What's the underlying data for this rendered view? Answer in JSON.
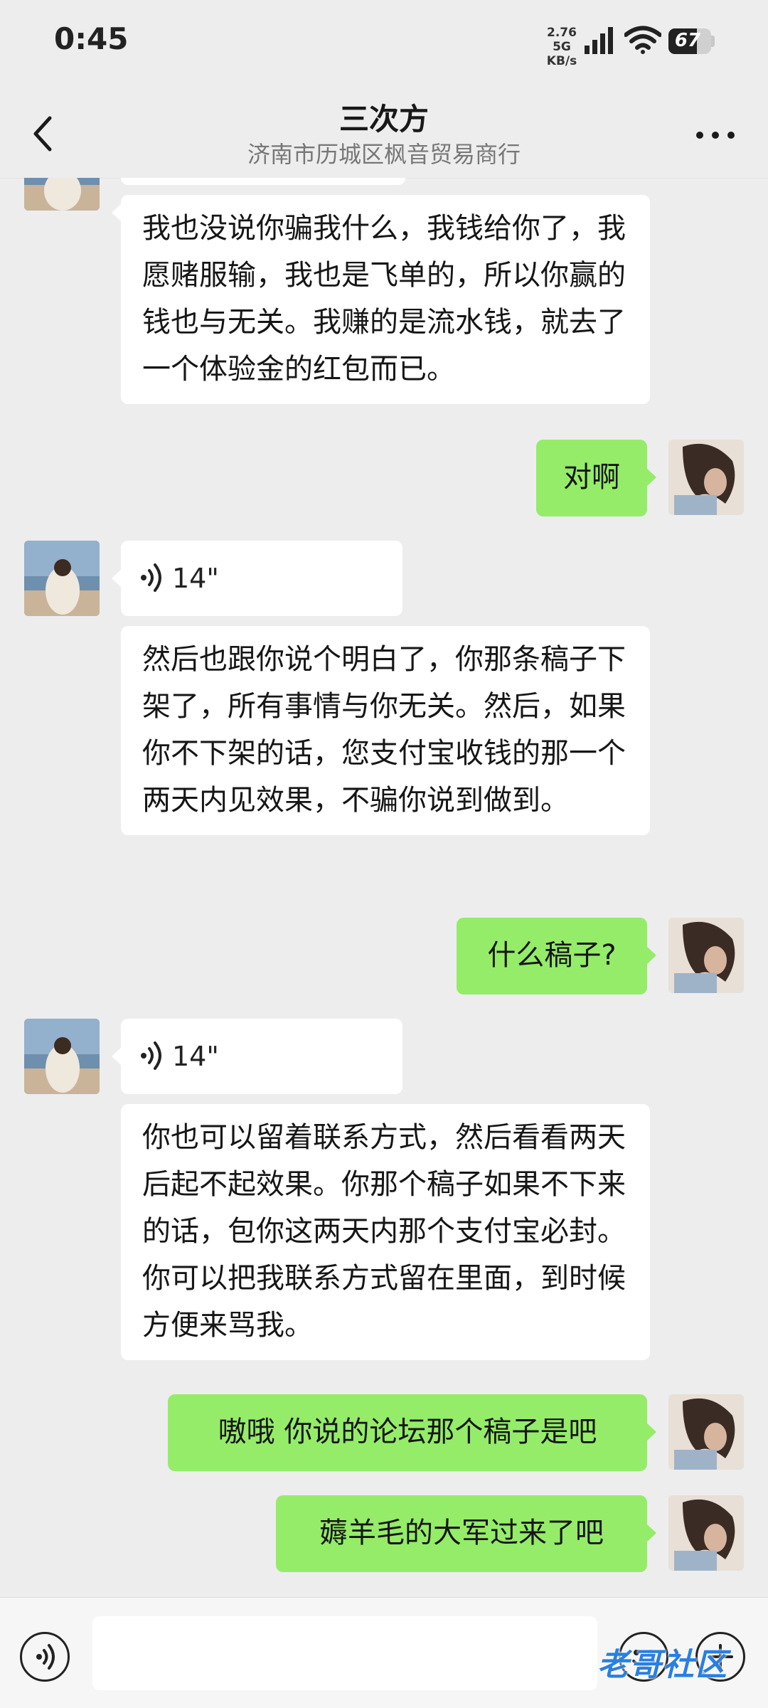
{
  "status_bar": {
    "time": "0:45",
    "net_speed_value": "2.76",
    "net_speed_unit": "KB/s",
    "network_type": "5G",
    "battery": "67",
    "battery_level": 0.67
  },
  "header": {
    "title": "三次方",
    "subtitle": "济南市历城区枫音贸易商行"
  },
  "messages": [
    {
      "side": "left",
      "type": "text",
      "text": "我也没说你骗我什么，我钱给你了，我愿赌服输，我也是飞单的，所以你赢的钱也与无关。我赚的是流水钱，就去了一个体验金的红包而已。"
    },
    {
      "side": "right",
      "type": "text",
      "text": "对啊"
    },
    {
      "side": "left",
      "type": "voice",
      "duration": "14\""
    },
    {
      "side": "left",
      "type": "text",
      "text": "然后也跟你说个明白了，你那条稿子下架了，所有事情与你无关。然后，如果你不下架的话，您支付宝收钱的那一个两天内见效果，不骗你说到做到。"
    },
    {
      "side": "right",
      "type": "text",
      "text": "什么稿子?"
    },
    {
      "side": "left",
      "type": "voice",
      "duration": "14\""
    },
    {
      "side": "left",
      "type": "text",
      "text": "你也可以留着联系方式，然后看看两天后起不起效果。你那个稿子如果不下来的话，包你这两天内那个支付宝必封。你可以把我联系方式留在里面，到时候方便来骂我。"
    },
    {
      "side": "right",
      "type": "text",
      "text": "嗷哦 你说的论坛那个稿子是吧"
    },
    {
      "side": "right",
      "type": "text",
      "text": "薅羊毛的大军过来了吧"
    }
  ],
  "watermark": "老哥社区",
  "colors": {
    "background": "#ededed",
    "right_bubble": "#95ec69",
    "left_bubble": "#ffffff"
  },
  "icons": [
    "back-arrow-icon",
    "more-icon",
    "voice-input-icon",
    "emoji-icon",
    "plus-icon",
    "voice-wave-icon",
    "signal-icon",
    "wifi-icon",
    "battery-icon"
  ]
}
